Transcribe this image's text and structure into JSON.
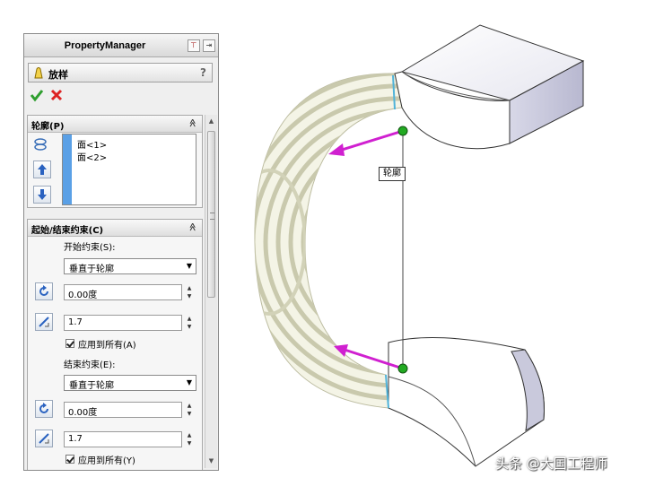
{
  "panel": {
    "title": "PropertyManager",
    "feature_name": "放样",
    "help": "?",
    "icons": {
      "feature": "loft-icon",
      "ok": "check-icon",
      "cancel": "x-icon"
    }
  },
  "profile_group": {
    "title": "轮廓(P)",
    "collapse": "≫",
    "items": [
      "面<1>",
      "面<2>"
    ]
  },
  "constraint_group": {
    "title": "起始/结束约束(C)",
    "collapse": "≫",
    "start_label": "开始约束(S):",
    "start_select": "垂直于轮廓",
    "start_angle": "0.00度",
    "start_length": "1.7",
    "start_apply_all": "应用到所有(A)",
    "end_label": "结束约束(E):",
    "end_select": "垂直于轮廓",
    "end_angle": "0.00度",
    "end_length": "1.7",
    "end_apply_all": "应用到所有(Y)"
  },
  "viewport": {
    "callout": "轮廓",
    "colors": {
      "arrow": "#d020d0",
      "handle": "#22aa22",
      "edge": "#4fb3d9",
      "body": "#f2f2fa"
    }
  },
  "watermark": "头条 @大国工程师"
}
